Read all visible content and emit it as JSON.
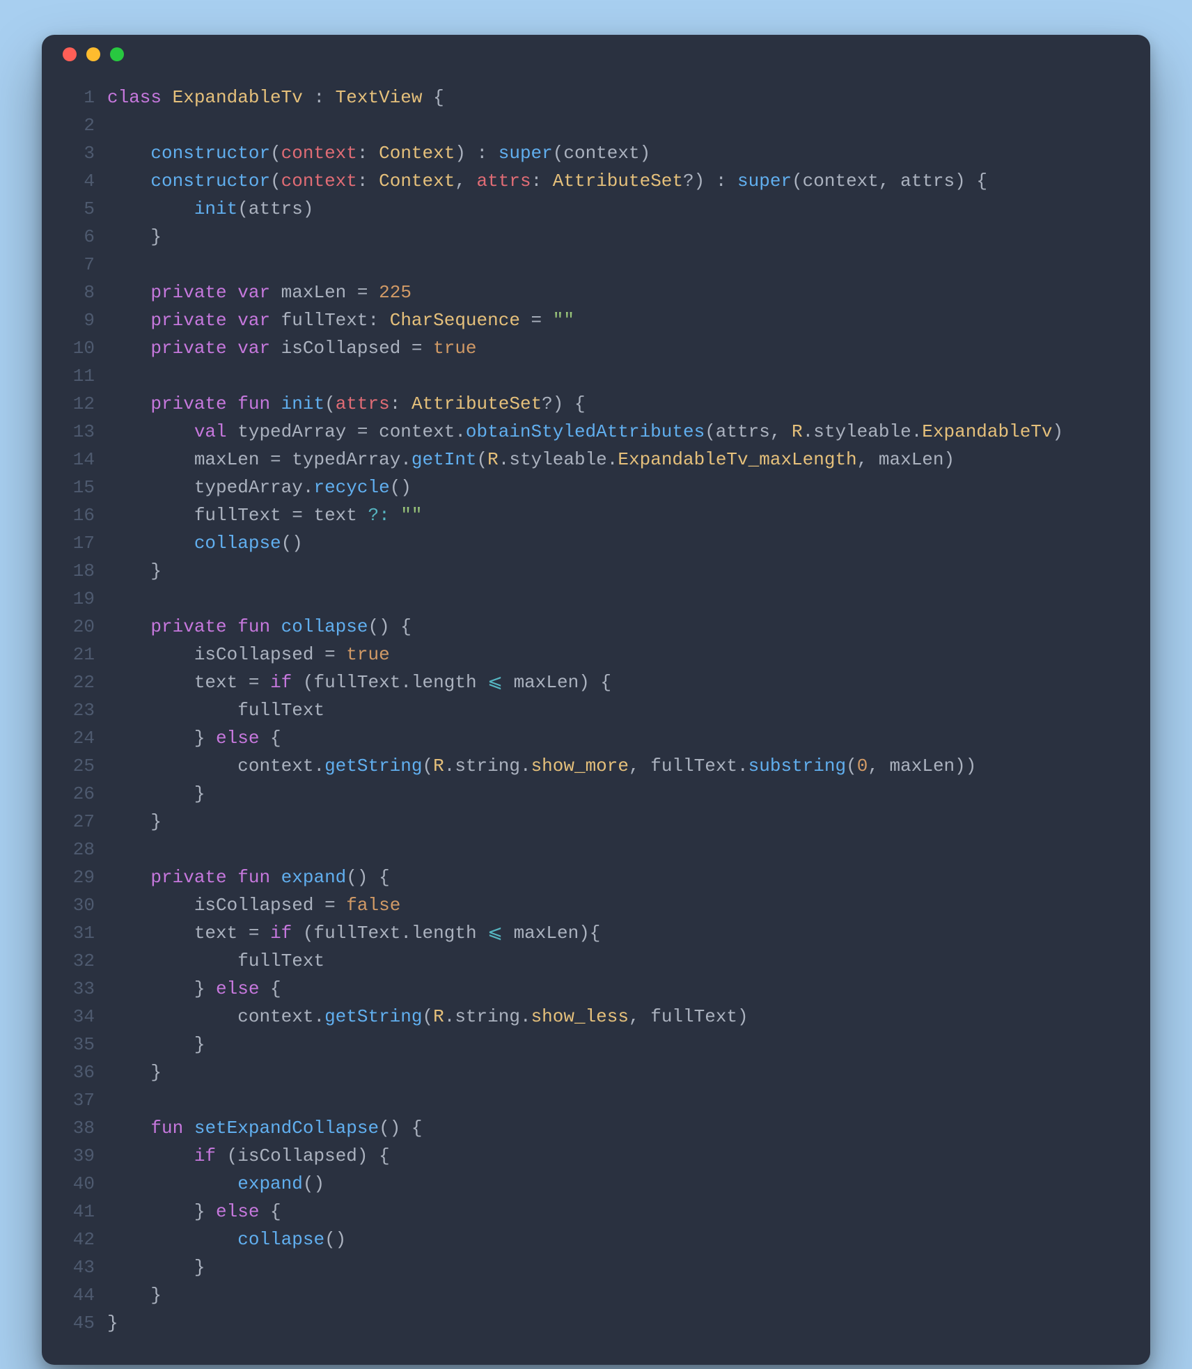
{
  "window": {
    "traffic_lights": [
      "close",
      "minimize",
      "zoom"
    ]
  },
  "code": {
    "language": "kotlin",
    "lines": [
      [
        {
          "t": "class ",
          "c": "kw"
        },
        {
          "t": "ExpandableTv",
          "c": "def"
        },
        {
          "t": " : ",
          "c": "punc"
        },
        {
          "t": "TextView",
          "c": "type"
        },
        {
          "t": " {",
          "c": "punc"
        }
      ],
      [],
      [
        {
          "t": "    ",
          "c": "punc"
        },
        {
          "t": "constructor",
          "c": "fn"
        },
        {
          "t": "(",
          "c": "punc"
        },
        {
          "t": "context",
          "c": "id"
        },
        {
          "t": ": ",
          "c": "punc"
        },
        {
          "t": "Context",
          "c": "type"
        },
        {
          "t": ") : ",
          "c": "punc"
        },
        {
          "t": "super",
          "c": "fn"
        },
        {
          "t": "(",
          "c": "punc"
        },
        {
          "t": "context",
          "c": "prop"
        },
        {
          "t": ")",
          "c": "punc"
        }
      ],
      [
        {
          "t": "    ",
          "c": "punc"
        },
        {
          "t": "constructor",
          "c": "fn"
        },
        {
          "t": "(",
          "c": "punc"
        },
        {
          "t": "context",
          "c": "id"
        },
        {
          "t": ": ",
          "c": "punc"
        },
        {
          "t": "Context",
          "c": "type"
        },
        {
          "t": ", ",
          "c": "punc"
        },
        {
          "t": "attrs",
          "c": "id"
        },
        {
          "t": ": ",
          "c": "punc"
        },
        {
          "t": "AttributeSet",
          "c": "type"
        },
        {
          "t": "?",
          "c": "punc"
        },
        {
          "t": ") : ",
          "c": "punc"
        },
        {
          "t": "super",
          "c": "fn"
        },
        {
          "t": "(",
          "c": "punc"
        },
        {
          "t": "context",
          "c": "prop"
        },
        {
          "t": ", ",
          "c": "punc"
        },
        {
          "t": "attrs",
          "c": "prop"
        },
        {
          "t": ") {",
          "c": "punc"
        }
      ],
      [
        {
          "t": "        ",
          "c": "punc"
        },
        {
          "t": "init",
          "c": "fn"
        },
        {
          "t": "(",
          "c": "punc"
        },
        {
          "t": "attrs",
          "c": "prop"
        },
        {
          "t": ")",
          "c": "punc"
        }
      ],
      [
        {
          "t": "    }",
          "c": "punc"
        }
      ],
      [],
      [
        {
          "t": "    ",
          "c": "punc"
        },
        {
          "t": "private",
          "c": "kw"
        },
        {
          "t": " ",
          "c": "punc"
        },
        {
          "t": "var",
          "c": "kw"
        },
        {
          "t": " ",
          "c": "punc"
        },
        {
          "t": "maxLen",
          "c": "prop"
        },
        {
          "t": " = ",
          "c": "punc"
        },
        {
          "t": "225",
          "c": "num"
        }
      ],
      [
        {
          "t": "    ",
          "c": "punc"
        },
        {
          "t": "private",
          "c": "kw"
        },
        {
          "t": " ",
          "c": "punc"
        },
        {
          "t": "var",
          "c": "kw"
        },
        {
          "t": " ",
          "c": "punc"
        },
        {
          "t": "fullText",
          "c": "prop"
        },
        {
          "t": ": ",
          "c": "punc"
        },
        {
          "t": "CharSequence",
          "c": "type"
        },
        {
          "t": " = ",
          "c": "punc"
        },
        {
          "t": "\"\"",
          "c": "str"
        }
      ],
      [
        {
          "t": "    ",
          "c": "punc"
        },
        {
          "t": "private",
          "c": "kw"
        },
        {
          "t": " ",
          "c": "punc"
        },
        {
          "t": "var",
          "c": "kw"
        },
        {
          "t": " ",
          "c": "punc"
        },
        {
          "t": "isCollapsed",
          "c": "prop"
        },
        {
          "t": " = ",
          "c": "punc"
        },
        {
          "t": "true",
          "c": "num"
        }
      ],
      [],
      [
        {
          "t": "    ",
          "c": "punc"
        },
        {
          "t": "private",
          "c": "kw"
        },
        {
          "t": " ",
          "c": "punc"
        },
        {
          "t": "fun",
          "c": "kw"
        },
        {
          "t": " ",
          "c": "punc"
        },
        {
          "t": "init",
          "c": "fn"
        },
        {
          "t": "(",
          "c": "punc"
        },
        {
          "t": "attrs",
          "c": "id"
        },
        {
          "t": ": ",
          "c": "punc"
        },
        {
          "t": "AttributeSet",
          "c": "type"
        },
        {
          "t": "?",
          "c": "punc"
        },
        {
          "t": ") {",
          "c": "punc"
        }
      ],
      [
        {
          "t": "        ",
          "c": "punc"
        },
        {
          "t": "val",
          "c": "kw"
        },
        {
          "t": " ",
          "c": "punc"
        },
        {
          "t": "typedArray",
          "c": "prop"
        },
        {
          "t": " = ",
          "c": "punc"
        },
        {
          "t": "context",
          "c": "prop"
        },
        {
          "t": ".",
          "c": "punc"
        },
        {
          "t": "obtainStyledAttributes",
          "c": "fn"
        },
        {
          "t": "(",
          "c": "punc"
        },
        {
          "t": "attrs",
          "c": "prop"
        },
        {
          "t": ", ",
          "c": "punc"
        },
        {
          "t": "R",
          "c": "type"
        },
        {
          "t": ".",
          "c": "punc"
        },
        {
          "t": "styleable",
          "c": "prop"
        },
        {
          "t": ".",
          "c": "punc"
        },
        {
          "t": "ExpandableTv",
          "c": "type"
        },
        {
          "t": ")",
          "c": "punc"
        }
      ],
      [
        {
          "t": "        ",
          "c": "punc"
        },
        {
          "t": "maxLen",
          "c": "prop"
        },
        {
          "t": " = ",
          "c": "punc"
        },
        {
          "t": "typedArray",
          "c": "prop"
        },
        {
          "t": ".",
          "c": "punc"
        },
        {
          "t": "getInt",
          "c": "fn"
        },
        {
          "t": "(",
          "c": "punc"
        },
        {
          "t": "R",
          "c": "type"
        },
        {
          "t": ".",
          "c": "punc"
        },
        {
          "t": "styleable",
          "c": "prop"
        },
        {
          "t": ".",
          "c": "punc"
        },
        {
          "t": "ExpandableTv_maxLength",
          "c": "type"
        },
        {
          "t": ", ",
          "c": "punc"
        },
        {
          "t": "maxLen",
          "c": "prop"
        },
        {
          "t": ")",
          "c": "punc"
        }
      ],
      [
        {
          "t": "        ",
          "c": "punc"
        },
        {
          "t": "typedArray",
          "c": "prop"
        },
        {
          "t": ".",
          "c": "punc"
        },
        {
          "t": "recycle",
          "c": "fn"
        },
        {
          "t": "()",
          "c": "punc"
        }
      ],
      [
        {
          "t": "        ",
          "c": "punc"
        },
        {
          "t": "fullText",
          "c": "prop"
        },
        {
          "t": " = ",
          "c": "punc"
        },
        {
          "t": "text",
          "c": "prop"
        },
        {
          "t": " ?: ",
          "c": "op"
        },
        {
          "t": "\"\"",
          "c": "str"
        }
      ],
      [
        {
          "t": "        ",
          "c": "punc"
        },
        {
          "t": "collapse",
          "c": "fn"
        },
        {
          "t": "()",
          "c": "punc"
        }
      ],
      [
        {
          "t": "    }",
          "c": "punc"
        }
      ],
      [],
      [
        {
          "t": "    ",
          "c": "punc"
        },
        {
          "t": "private",
          "c": "kw"
        },
        {
          "t": " ",
          "c": "punc"
        },
        {
          "t": "fun",
          "c": "kw"
        },
        {
          "t": " ",
          "c": "punc"
        },
        {
          "t": "collapse",
          "c": "fn"
        },
        {
          "t": "() {",
          "c": "punc"
        }
      ],
      [
        {
          "t": "        ",
          "c": "punc"
        },
        {
          "t": "isCollapsed",
          "c": "prop"
        },
        {
          "t": " = ",
          "c": "punc"
        },
        {
          "t": "true",
          "c": "num"
        }
      ],
      [
        {
          "t": "        ",
          "c": "punc"
        },
        {
          "t": "text",
          "c": "prop"
        },
        {
          "t": " = ",
          "c": "punc"
        },
        {
          "t": "if",
          "c": "kw"
        },
        {
          "t": " (",
          "c": "punc"
        },
        {
          "t": "fullText",
          "c": "prop"
        },
        {
          "t": ".",
          "c": "punc"
        },
        {
          "t": "length",
          "c": "prop"
        },
        {
          "t": " ",
          "c": "punc"
        },
        {
          "t": "⩽",
          "c": "op"
        },
        {
          "t": " ",
          "c": "punc"
        },
        {
          "t": "maxLen",
          "c": "prop"
        },
        {
          "t": ") {",
          "c": "punc"
        }
      ],
      [
        {
          "t": "            ",
          "c": "punc"
        },
        {
          "t": "fullText",
          "c": "prop"
        }
      ],
      [
        {
          "t": "        } ",
          "c": "punc"
        },
        {
          "t": "else",
          "c": "kw"
        },
        {
          "t": " {",
          "c": "punc"
        }
      ],
      [
        {
          "t": "            ",
          "c": "punc"
        },
        {
          "t": "context",
          "c": "prop"
        },
        {
          "t": ".",
          "c": "punc"
        },
        {
          "t": "getString",
          "c": "fn"
        },
        {
          "t": "(",
          "c": "punc"
        },
        {
          "t": "R",
          "c": "type"
        },
        {
          "t": ".",
          "c": "punc"
        },
        {
          "t": "string",
          "c": "prop"
        },
        {
          "t": ".",
          "c": "punc"
        },
        {
          "t": "show_more",
          "c": "type"
        },
        {
          "t": ", ",
          "c": "punc"
        },
        {
          "t": "fullText",
          "c": "prop"
        },
        {
          "t": ".",
          "c": "punc"
        },
        {
          "t": "substring",
          "c": "fn"
        },
        {
          "t": "(",
          "c": "punc"
        },
        {
          "t": "0",
          "c": "num"
        },
        {
          "t": ", ",
          "c": "punc"
        },
        {
          "t": "maxLen",
          "c": "prop"
        },
        {
          "t": "))",
          "c": "punc"
        }
      ],
      [
        {
          "t": "        }",
          "c": "punc"
        }
      ],
      [
        {
          "t": "    }",
          "c": "punc"
        }
      ],
      [],
      [
        {
          "t": "    ",
          "c": "punc"
        },
        {
          "t": "private",
          "c": "kw"
        },
        {
          "t": " ",
          "c": "punc"
        },
        {
          "t": "fun",
          "c": "kw"
        },
        {
          "t": " ",
          "c": "punc"
        },
        {
          "t": "expand",
          "c": "fn"
        },
        {
          "t": "() {",
          "c": "punc"
        }
      ],
      [
        {
          "t": "        ",
          "c": "punc"
        },
        {
          "t": "isCollapsed",
          "c": "prop"
        },
        {
          "t": " = ",
          "c": "punc"
        },
        {
          "t": "false",
          "c": "num"
        }
      ],
      [
        {
          "t": "        ",
          "c": "punc"
        },
        {
          "t": "text",
          "c": "prop"
        },
        {
          "t": " = ",
          "c": "punc"
        },
        {
          "t": "if",
          "c": "kw"
        },
        {
          "t": " (",
          "c": "punc"
        },
        {
          "t": "fullText",
          "c": "prop"
        },
        {
          "t": ".",
          "c": "punc"
        },
        {
          "t": "length",
          "c": "prop"
        },
        {
          "t": " ",
          "c": "punc"
        },
        {
          "t": "⩽",
          "c": "op"
        },
        {
          "t": " ",
          "c": "punc"
        },
        {
          "t": "maxLen",
          "c": "prop"
        },
        {
          "t": "){",
          "c": "punc"
        }
      ],
      [
        {
          "t": "            ",
          "c": "punc"
        },
        {
          "t": "fullText",
          "c": "prop"
        }
      ],
      [
        {
          "t": "        } ",
          "c": "punc"
        },
        {
          "t": "else",
          "c": "kw"
        },
        {
          "t": " {",
          "c": "punc"
        }
      ],
      [
        {
          "t": "            ",
          "c": "punc"
        },
        {
          "t": "context",
          "c": "prop"
        },
        {
          "t": ".",
          "c": "punc"
        },
        {
          "t": "getString",
          "c": "fn"
        },
        {
          "t": "(",
          "c": "punc"
        },
        {
          "t": "R",
          "c": "type"
        },
        {
          "t": ".",
          "c": "punc"
        },
        {
          "t": "string",
          "c": "prop"
        },
        {
          "t": ".",
          "c": "punc"
        },
        {
          "t": "show_less",
          "c": "type"
        },
        {
          "t": ", ",
          "c": "punc"
        },
        {
          "t": "fullText",
          "c": "prop"
        },
        {
          "t": ")",
          "c": "punc"
        }
      ],
      [
        {
          "t": "        }",
          "c": "punc"
        }
      ],
      [
        {
          "t": "    }",
          "c": "punc"
        }
      ],
      [],
      [
        {
          "t": "    ",
          "c": "punc"
        },
        {
          "t": "fun",
          "c": "kw"
        },
        {
          "t": " ",
          "c": "punc"
        },
        {
          "t": "setExpandCollapse",
          "c": "fn"
        },
        {
          "t": "() {",
          "c": "punc"
        }
      ],
      [
        {
          "t": "        ",
          "c": "punc"
        },
        {
          "t": "if",
          "c": "kw"
        },
        {
          "t": " (",
          "c": "punc"
        },
        {
          "t": "isCollapsed",
          "c": "prop"
        },
        {
          "t": ") {",
          "c": "punc"
        }
      ],
      [
        {
          "t": "            ",
          "c": "punc"
        },
        {
          "t": "expand",
          "c": "fn"
        },
        {
          "t": "()",
          "c": "punc"
        }
      ],
      [
        {
          "t": "        } ",
          "c": "punc"
        },
        {
          "t": "else",
          "c": "kw"
        },
        {
          "t": " {",
          "c": "punc"
        }
      ],
      [
        {
          "t": "            ",
          "c": "punc"
        },
        {
          "t": "collapse",
          "c": "fn"
        },
        {
          "t": "()",
          "c": "punc"
        }
      ],
      [
        {
          "t": "        }",
          "c": "punc"
        }
      ],
      [
        {
          "t": "    }",
          "c": "punc"
        }
      ],
      [
        {
          "t": "}",
          "c": "punc"
        }
      ]
    ]
  }
}
